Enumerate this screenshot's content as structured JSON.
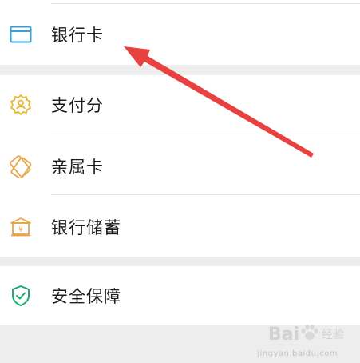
{
  "menu": {
    "items": [
      {
        "label": "银行卡",
        "icon": "bank-card-icon",
        "color": "#3aa0d8"
      },
      {
        "label": "支付分",
        "icon": "pay-score-icon",
        "color": "#e9b92a"
      },
      {
        "label": "亲属卡",
        "icon": "family-card-icon",
        "color": "#e8a54a"
      },
      {
        "label": "银行储蓄",
        "icon": "bank-savings-icon",
        "color": "#e8a54a"
      },
      {
        "label": "安全保障",
        "icon": "security-shield-icon",
        "color": "#1aaa74"
      }
    ]
  },
  "annotation": {
    "arrow_color": "#e8413f"
  },
  "watermark": {
    "text": "Bai",
    "sub": "经验",
    "site": "jingyan.baidu.com"
  }
}
